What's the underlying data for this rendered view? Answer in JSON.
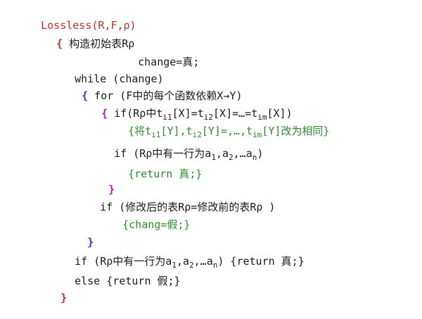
{
  "lines": {
    "l1": "Lossless(R,F,ρ)",
    "l2_brace": "{",
    "l2_text": " 构造初始表Rρ",
    "l3": "change=真;",
    "l4": "while (change)",
    "l5_brace": "{",
    "l5_text": " for (F中的每个函数依赖X→Y)",
    "l6_brace": "{",
    "l6_a": " if(Rρ中t",
    "l6_sub1": "i1",
    "l6_b": "[X]=t",
    "l6_sub2": "i2",
    "l6_c": "[X]=…=t",
    "l6_sub3": "im",
    "l6_d": "[X])",
    "l7_a": "{将t",
    "l7_sub1": "i1",
    "l7_b": "[Y],t",
    "l7_sub2": "i2",
    "l7_c": "[Y]=,…,t",
    "l7_sub3": "im",
    "l7_d": "[Y]改为相同}",
    "l8_a": "if (Rρ中有一行为a",
    "l8_sub1": "1",
    "l8_b": ",a",
    "l8_sub2": "2",
    "l8_c": ",…a",
    "l8_sub3": "n",
    "l8_d": ")",
    "l9": "{return 真;}",
    "l10": "}",
    "l11": "if (修改后的表Rρ=修改前的表Rρ )",
    "l12": "{chang=假;}",
    "l13": "}",
    "l14_a": "if (Rρ中有一行为a",
    "l14_sub1": "1",
    "l14_b": ",a",
    "l14_sub2": "2",
    "l14_c": ",…a",
    "l14_sub3": "n",
    "l14_d": ") {return 真;}",
    "l15": "else {return 假;}",
    "l16": "}"
  }
}
